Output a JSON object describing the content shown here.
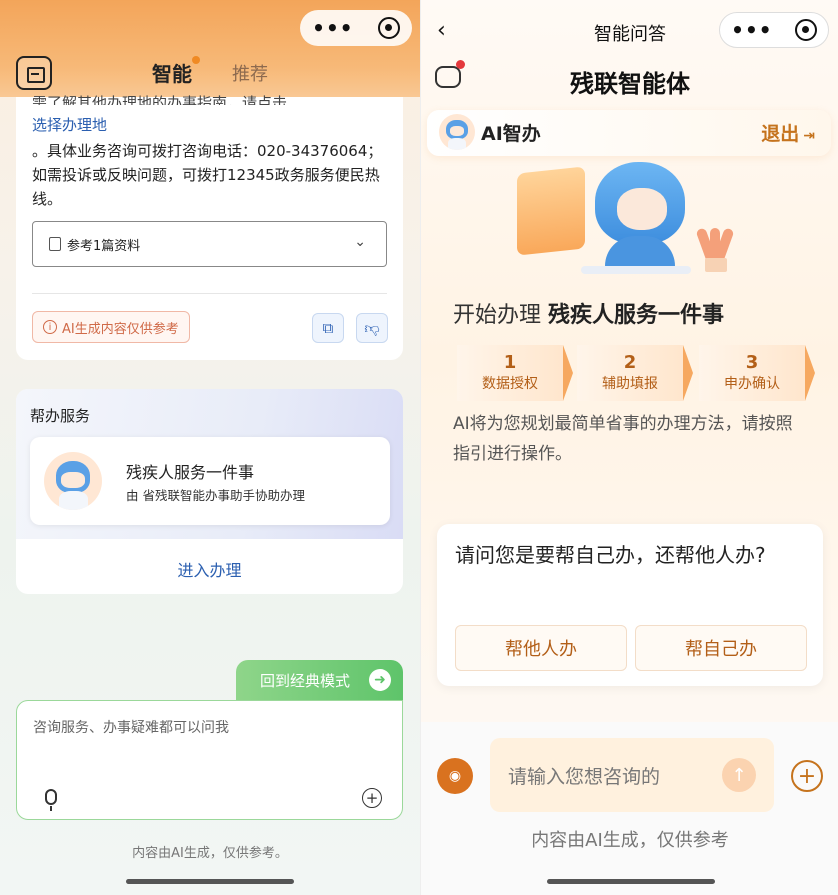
{
  "left": {
    "tabs": {
      "smart": "智能",
      "recommend": "推荐"
    },
    "answer": {
      "line1_partial": "需了解其他办理地的办事指南，请点击",
      "link": "选择办理地",
      "para": "。具体业务咨询可拨打咨询电话：020-34376064；如需投诉或反映问题，可拨打12345政务服务便民热线。",
      "reference_label": "参考1篇资料",
      "ai_notice": "AI生成内容仅供参考"
    },
    "help_service": {
      "title": "帮办服务",
      "item_name": "残疾人服务一件事",
      "item_desc": "由 省残联智能办事助手协助办理",
      "enter_label": "进入办理"
    },
    "classic_mode_label": "回到经典模式",
    "input_placeholder": "咨询服务、办事疑难都可以问我",
    "footer": "内容由AI生成，仅供参考。"
  },
  "right": {
    "nav_title": "智能问答",
    "agent_title": "残联智能体",
    "ai_name": "AI智办",
    "exit_label": "退出",
    "flow": {
      "prefix": "开始办理",
      "service": "残疾人服务一件事",
      "steps": [
        {
          "num": "1",
          "label": "数据授权"
        },
        {
          "num": "2",
          "label": "辅助填报"
        },
        {
          "num": "3",
          "label": "申办确认"
        }
      ],
      "desc": "AI将为您规划最简单省事的办理方法，请按照指引进行操作。"
    },
    "question": {
      "text": "请问您是要帮自己办，还帮他人办?",
      "option_other": "帮他人办",
      "option_self": "帮自己办"
    },
    "input_placeholder": "请输入您想咨询的",
    "footer": "内容由AI生成，仅供参考"
  },
  "colors": {
    "accent_orange": "#f3a55a",
    "link_blue": "#2b5fb0",
    "classic_green": "#5ec46a",
    "brand_brown": "#c5731d"
  },
  "icons": [
    "more-icon",
    "target-icon",
    "menu-icon",
    "doc-icon",
    "chevron-down-icon",
    "info-icon",
    "copy-icon",
    "thumb-down-icon",
    "arrow-right-icon",
    "mic-icon",
    "plus-icon",
    "back-icon",
    "history-icon",
    "exit-icon",
    "voice-icon",
    "send-icon"
  ]
}
